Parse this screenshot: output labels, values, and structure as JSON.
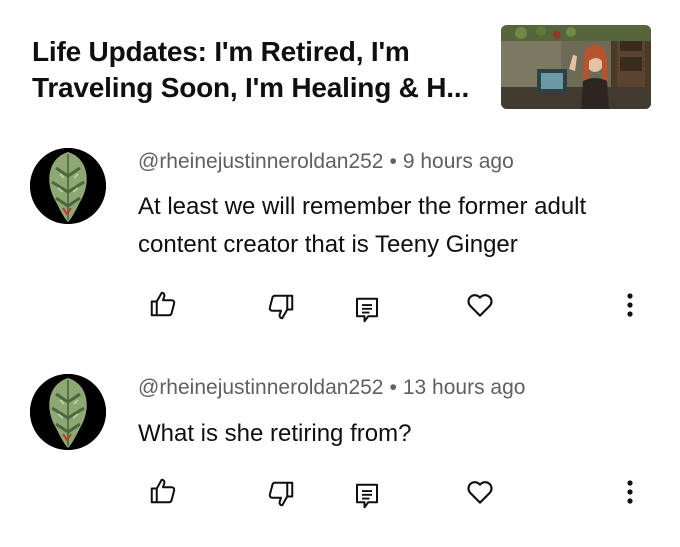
{
  "video": {
    "title_line1": "Life Updates: I'm Retired, I'm",
    "title_line2": "Traveling Soon, I'm Healing & H..."
  },
  "comments": [
    {
      "author": "@rheinejustinneroldan252",
      "separator": "•",
      "time": "9 hours ago",
      "text_line1": "At least we will remember the former adult",
      "text_line2": "content creator that is Teeny Ginger"
    },
    {
      "author": "@rheinejustinneroldan252",
      "separator": "•",
      "time": "13 hours ago",
      "text_line1": "What is she retiring from?"
    }
  ],
  "icons": {
    "like": "thumbs-up-icon",
    "dislike": "thumbs-down-icon",
    "reply": "reply-comment-icon",
    "heart": "heart-icon",
    "more": "more-vertical-icon"
  },
  "colors": {
    "text_primary": "#0f0f0f",
    "text_secondary": "#606060",
    "avatar_bg": "#000000",
    "avatar_leaf": "#8da872"
  }
}
